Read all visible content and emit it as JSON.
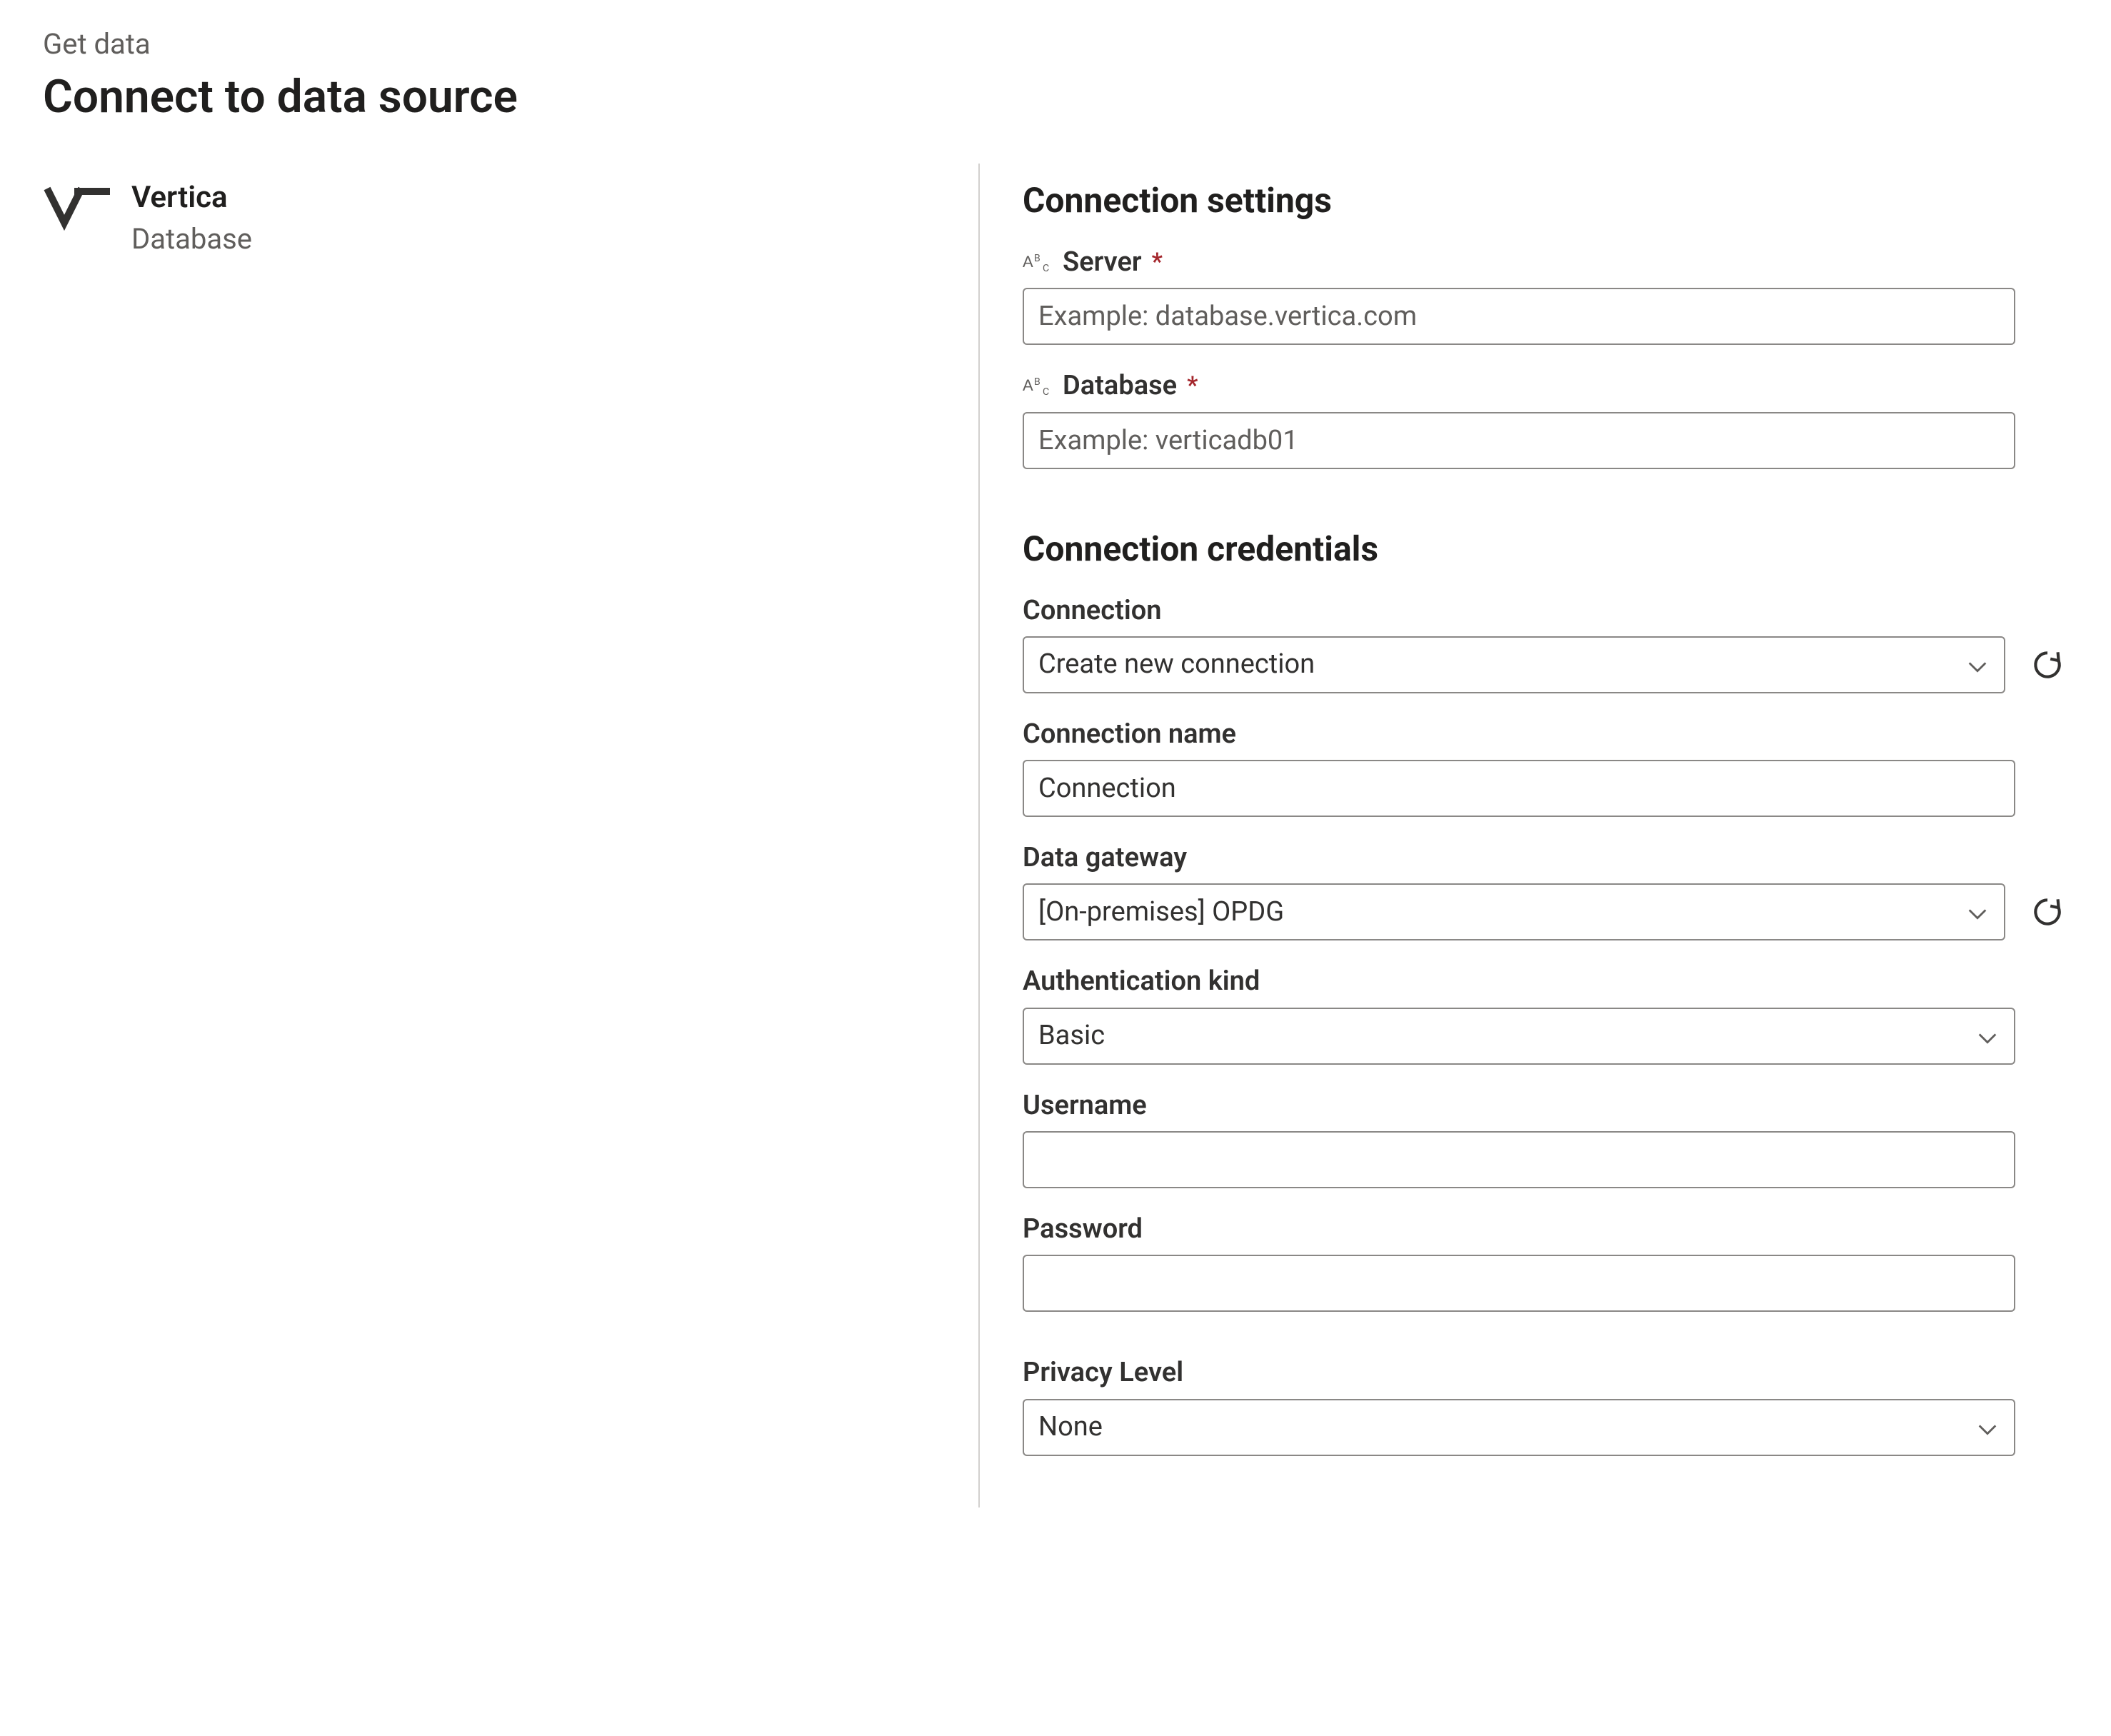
{
  "header": {
    "breadcrumb": "Get data",
    "title": "Connect to data source"
  },
  "connector": {
    "name": "Vertica",
    "category": "Database"
  },
  "settings": {
    "heading": "Connection settings",
    "server": {
      "label": "Server",
      "required": "*",
      "placeholder": "Example: database.vertica.com",
      "value": ""
    },
    "database": {
      "label": "Database",
      "required": "*",
      "placeholder": "Example: verticadb01",
      "value": ""
    }
  },
  "credentials": {
    "heading": "Connection credentials",
    "connection": {
      "label": "Connection",
      "value": "Create new connection"
    },
    "connection_name": {
      "label": "Connection name",
      "value": "Connection"
    },
    "data_gateway": {
      "label": "Data gateway",
      "value": "[On-premises] OPDG"
    },
    "auth_kind": {
      "label": "Authentication kind",
      "value": "Basic"
    },
    "username": {
      "label": "Username",
      "value": ""
    },
    "password": {
      "label": "Password",
      "value": ""
    },
    "privacy_level": {
      "label": "Privacy Level",
      "value": "None"
    }
  }
}
